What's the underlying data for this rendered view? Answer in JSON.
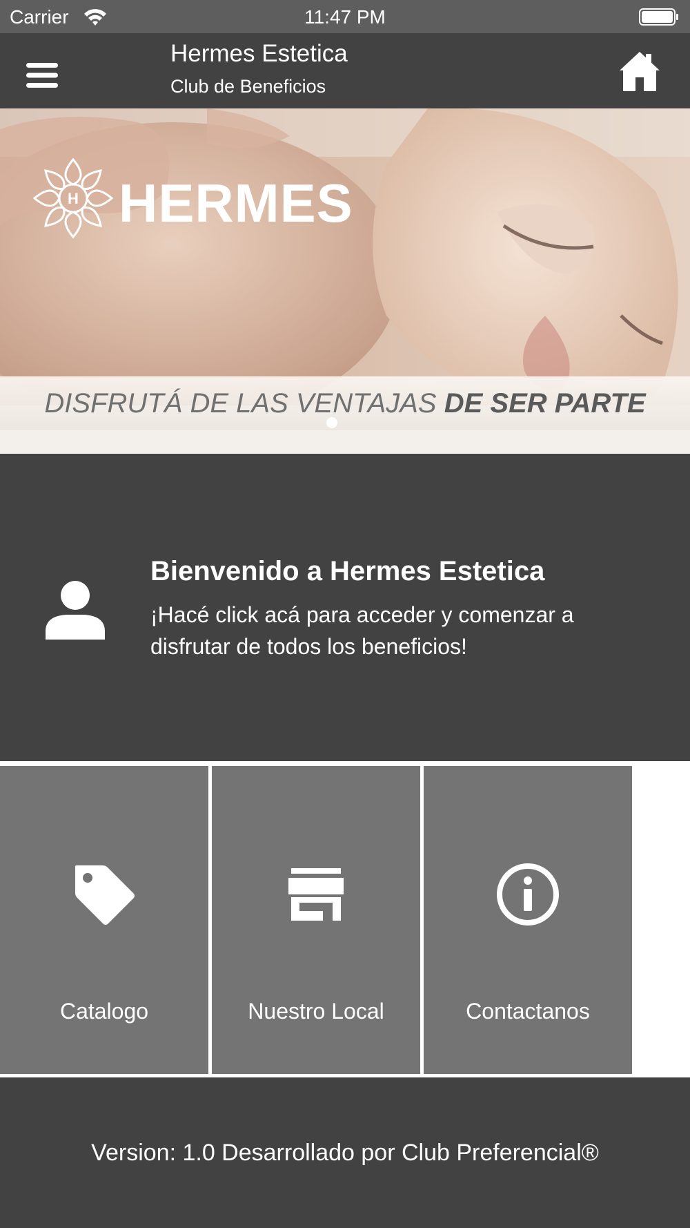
{
  "status_bar": {
    "carrier": "Carrier",
    "time": "11:47 PM",
    "wifi_icon": "wifi-icon",
    "battery_icon": "battery-icon"
  },
  "header": {
    "title": "Hermes Estetica",
    "subtitle": "Club de Beneficios",
    "menu_icon": "hamburger-menu-icon",
    "home_icon": "home-icon",
    "background_color": "#424242"
  },
  "banner": {
    "brand": "HERMES",
    "tagline_regular": "DISFRUTÁ DE LAS VENTAJAS",
    "tagline_bold": "DE SER PARTE",
    "slide_count": 1,
    "active_slide": 1
  },
  "welcome": {
    "title": "Bienvenido a Hermes Estetica",
    "text": "¡Hacé click acá para acceder y comenzar a disfrutar de todos los beneficios!",
    "icon": "user-icon"
  },
  "tiles": [
    {
      "label": "Catalogo",
      "icon": "tag-icon"
    },
    {
      "label": "Nuestro Local",
      "icon": "store-icon"
    },
    {
      "label": "Contactanos",
      "icon": "info-icon"
    }
  ],
  "footer": {
    "text": "Version: 1.0 Desarrollado por Club Preferencial®"
  },
  "colors": {
    "dark_gray": "#424242",
    "tile_gray": "#747474",
    "status_gray": "#5e5e5e"
  }
}
